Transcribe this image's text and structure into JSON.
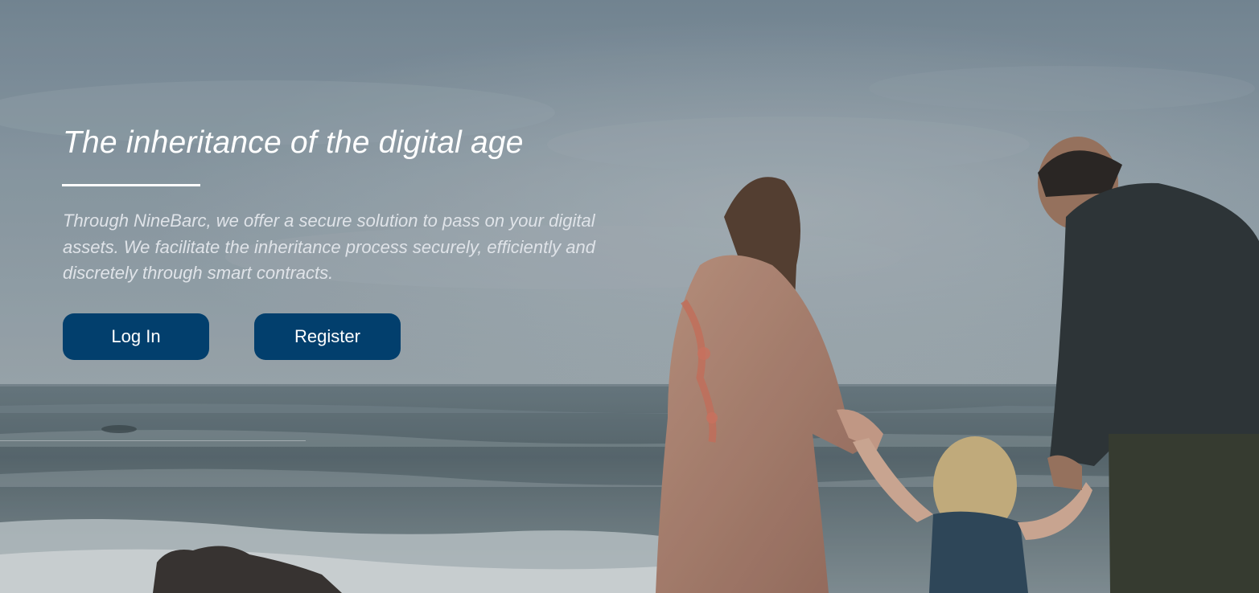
{
  "hero": {
    "title": "The inheritance of the digital age",
    "description": "Through NineBarc, we offer a secure solution to pass on your digital assets. We facilitate the inheritance process securely, efficiently and discretely through smart contracts.",
    "login_label": "Log In",
    "register_label": "Register",
    "background_image": "family-walking-on-beach"
  },
  "colors": {
    "button_bg": "#023f6d",
    "button_text": "#ffffff",
    "title_text": "#ffffff",
    "description_text": "#dfe3e8"
  }
}
